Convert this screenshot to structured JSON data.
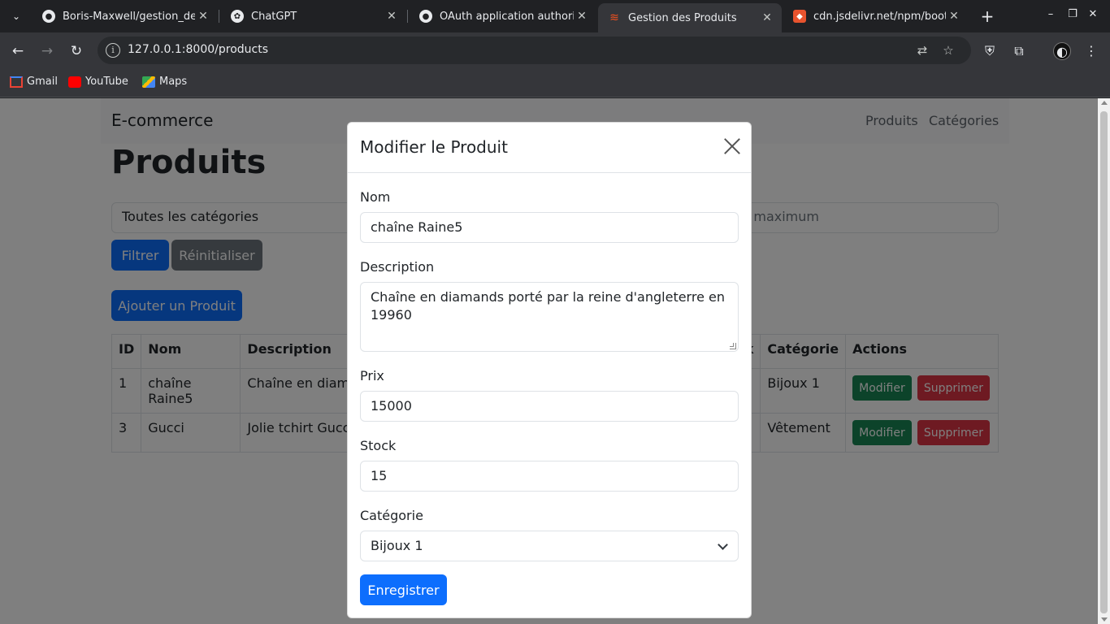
{
  "browser": {
    "tabs": [
      {
        "title": "Boris-Maxwell/gestion_de_",
        "icon": "github-icon"
      },
      {
        "title": "ChatGPT",
        "icon": "chatgpt-icon"
      },
      {
        "title": "OAuth application authoriz",
        "icon": "github-icon"
      },
      {
        "title": "Gestion des Produits",
        "icon": "laravel-icon",
        "active": true
      },
      {
        "title": "cdn.jsdelivr.net/npm/boots",
        "icon": "jsdelivr-icon"
      }
    ],
    "url": "127.0.0.1:8000/products",
    "bookmarks": [
      {
        "label": "Gmail",
        "icon": "gmail-icon"
      },
      {
        "label": "YouTube",
        "icon": "youtube-icon"
      },
      {
        "label": "Maps",
        "icon": "maps-icon"
      }
    ]
  },
  "navbar": {
    "brand": "E-commerce",
    "links": [
      "Produits",
      "Catégories"
    ]
  },
  "page": {
    "title": "Produits",
    "filter_category": "Toutes les catégories",
    "filter_stock_placeholder": "k maximum",
    "filter_button": "Filtrer",
    "reset_button": "Réinitialiser",
    "add_button": "Ajouter un Produit"
  },
  "table": {
    "headers": {
      "id": "ID",
      "name": "Nom",
      "description": "Description",
      "stock_tail": "k",
      "category": "Catégorie",
      "actions": "Actions"
    },
    "rows": [
      {
        "id": "1",
        "name": "chaîne Raine5",
        "description": "Chaîne en diama",
        "category": "Bijoux 1"
      },
      {
        "id": "3",
        "name": "Gucci",
        "description": "Jolie tchirt Gucci",
        "category": "Vêtement"
      }
    ],
    "edit_label": "Modifier",
    "delete_label": "Supprimer"
  },
  "modal": {
    "title": "Modifier le Produit",
    "name_label": "Nom",
    "name_value": "chaîne Raine5",
    "description_label": "Description",
    "description_value": "Chaîne en diamands porté par la reine d'angleterre en 19960",
    "price_label": "Prix",
    "price_value": "15000",
    "stock_label": "Stock",
    "stock_value": "15",
    "category_label": "Catégorie",
    "category_value": "Bijoux 1",
    "save_button": "Enregistrer"
  },
  "colors": {
    "primary": "#0d6efd",
    "secondary": "#6c757d",
    "success": "#198754",
    "danger": "#dc3545"
  }
}
